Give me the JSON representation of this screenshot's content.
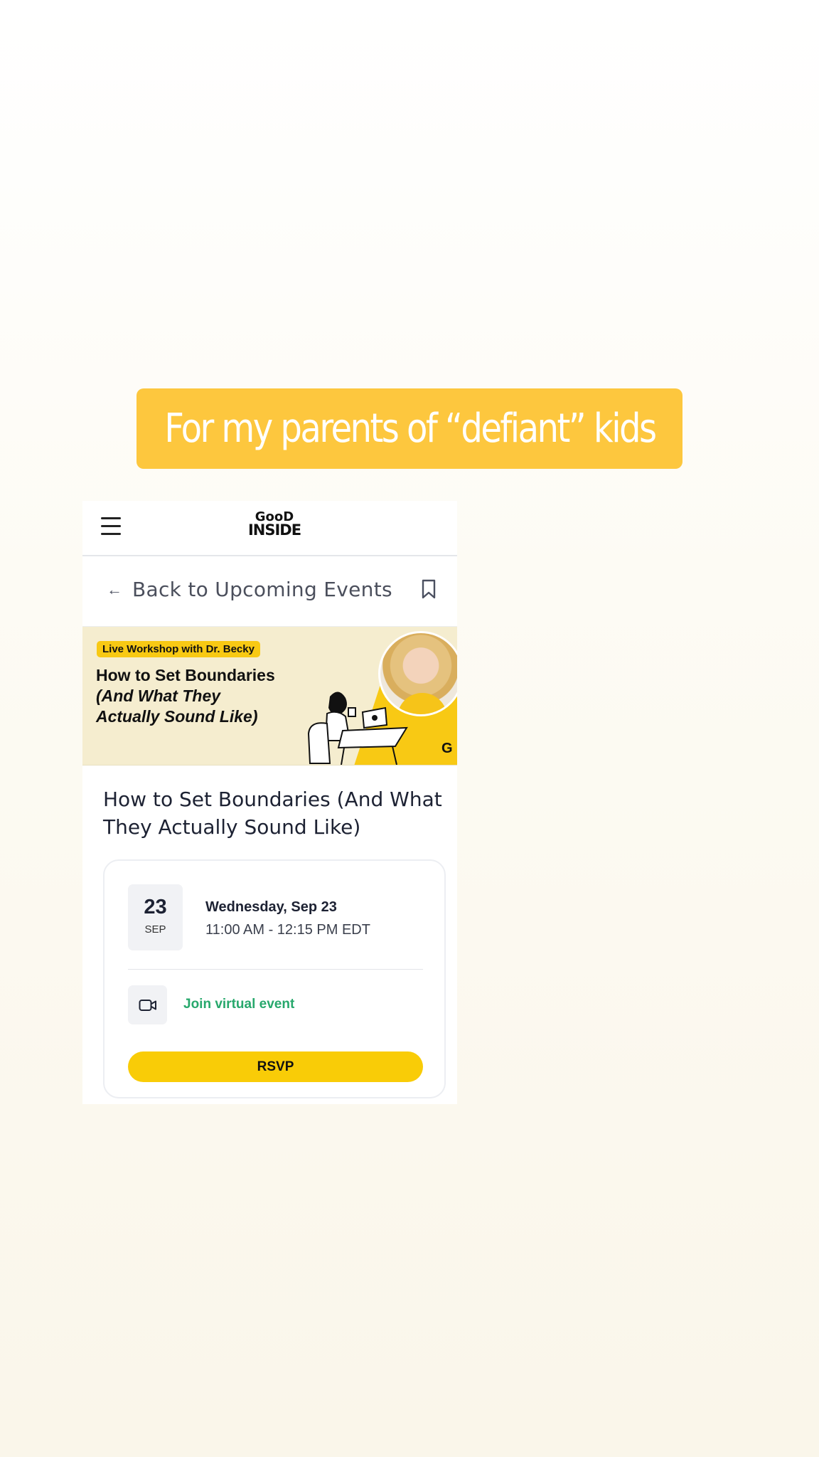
{
  "story": {
    "caption": "For my parents of “defiant” kids"
  },
  "header": {
    "logo_line1": "GooD",
    "logo_line2": "INSIDE",
    "menu_icon": "hamburger-icon"
  },
  "nav": {
    "back_label": "Back to Upcoming Events",
    "back_icon": "arrow-left-icon",
    "bookmark_icon": "bookmark-icon"
  },
  "banner": {
    "tag": "Live Workshop with Dr. Becky",
    "title_line1": "How to Set Boundaries",
    "title_line2": "(And What They",
    "title_line3": "Actually Sound Like)",
    "corner_mark": "G",
    "accent_color": "#f8c914"
  },
  "event": {
    "title": "How to Set Boundaries (And What They Actually Sound Like)",
    "date_day": "23",
    "date_month": "SEP",
    "date_text": "Wednesday, Sep 23",
    "time_text": "11:00 AM - 12:15 PM EDT",
    "join_label": "Join virtual event",
    "join_icon": "video-camera-icon",
    "join_color": "#27a86c",
    "rsvp_label": "RSVP",
    "rsvp_color": "#f9cc07"
  }
}
